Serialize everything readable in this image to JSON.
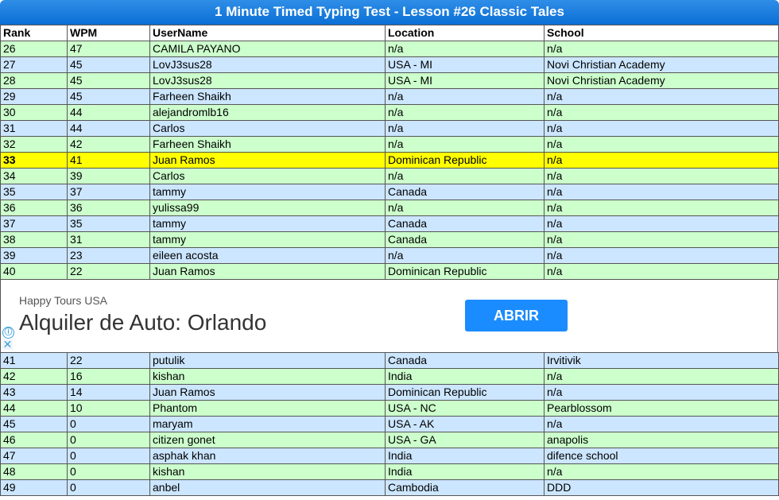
{
  "title": "1 Minute Timed Typing Test - Lesson #26 Classic Tales",
  "headers": [
    "Rank",
    "WPM",
    "UserName",
    "Location",
    "School"
  ],
  "rows_top": [
    {
      "rank": "26",
      "wpm": "47",
      "user": "CAMILA PAYANO",
      "location": "n/a",
      "school": "n/a",
      "style": "g"
    },
    {
      "rank": "27",
      "wpm": "45",
      "user": "LovJ3sus28",
      "location": "USA - MI",
      "school": "Novi Christian Academy",
      "style": "b"
    },
    {
      "rank": "28",
      "wpm": "45",
      "user": "LovJ3sus28",
      "location": "USA - MI",
      "school": "Novi Christian Academy",
      "style": "g"
    },
    {
      "rank": "29",
      "wpm": "45",
      "user": "Farheen Shaikh",
      "location": "n/a",
      "school": "n/a",
      "style": "b"
    },
    {
      "rank": "30",
      "wpm": "44",
      "user": "alejandromlb16",
      "location": "n/a",
      "school": "n/a",
      "style": "g"
    },
    {
      "rank": "31",
      "wpm": "44",
      "user": "Carlos",
      "location": "n/a",
      "school": "n/a",
      "style": "b"
    },
    {
      "rank": "32",
      "wpm": "42",
      "user": "Farheen Shaikh",
      "location": "n/a",
      "school": "n/a",
      "style": "g"
    },
    {
      "rank": "33",
      "wpm": "41",
      "user": "Juan Ramos",
      "location": "Dominican Republic",
      "school": "n/a",
      "style": "y"
    },
    {
      "rank": "34",
      "wpm": "39",
      "user": "Carlos",
      "location": "n/a",
      "school": "n/a",
      "style": "g"
    },
    {
      "rank": "35",
      "wpm": "37",
      "user": "tammy",
      "location": "Canada",
      "school": "n/a",
      "style": "b"
    },
    {
      "rank": "36",
      "wpm": "36",
      "user": "yulissa99",
      "location": "n/a",
      "school": "n/a",
      "style": "g"
    },
    {
      "rank": "37",
      "wpm": "35",
      "user": "tammy",
      "location": "Canada",
      "school": "n/a",
      "style": "b"
    },
    {
      "rank": "38",
      "wpm": "31",
      "user": "tammy",
      "location": "Canada",
      "school": "n/a",
      "style": "g"
    },
    {
      "rank": "39",
      "wpm": "23",
      "user": "eileen acosta",
      "location": "n/a",
      "school": "n/a",
      "style": "b"
    },
    {
      "rank": "40",
      "wpm": "22",
      "user": "Juan Ramos",
      "location": "Dominican Republic",
      "school": "n/a",
      "style": "g"
    }
  ],
  "ad": {
    "brand": "Happy Tours USA",
    "headline": "Alquiler de Auto: Orlando",
    "button": "ABRIR",
    "info_icon": "ⓘ",
    "close_icon": "✕"
  },
  "rows_bottom": [
    {
      "rank": "41",
      "wpm": "22",
      "user": "putulik",
      "location": "Canada",
      "school": "Irvitivik",
      "style": "b"
    },
    {
      "rank": "42",
      "wpm": "16",
      "user": "kishan",
      "location": "India",
      "school": "n/a",
      "style": "g"
    },
    {
      "rank": "43",
      "wpm": "14",
      "user": "Juan Ramos",
      "location": "Dominican Republic",
      "school": "n/a",
      "style": "b"
    },
    {
      "rank": "44",
      "wpm": "10",
      "user": "Phantom",
      "location": "USA - NC",
      "school": "Pearblossom",
      "style": "g"
    },
    {
      "rank": "45",
      "wpm": "0",
      "user": "maryam",
      "location": "USA - AK",
      "school": "n/a",
      "style": "b"
    },
    {
      "rank": "46",
      "wpm": "0",
      "user": "citizen gonet",
      "location": "USA - GA",
      "school": "anapolis",
      "style": "g"
    },
    {
      "rank": "47",
      "wpm": "0",
      "user": "asphak khan",
      "location": "India",
      "school": "difence school",
      "style": "b"
    },
    {
      "rank": "48",
      "wpm": "0",
      "user": "kishan",
      "location": "India",
      "school": "n/a",
      "style": "g"
    },
    {
      "rank": "49",
      "wpm": "0",
      "user": "anbel",
      "location": "Cambodia",
      "school": "DDD",
      "style": "b"
    }
  ]
}
